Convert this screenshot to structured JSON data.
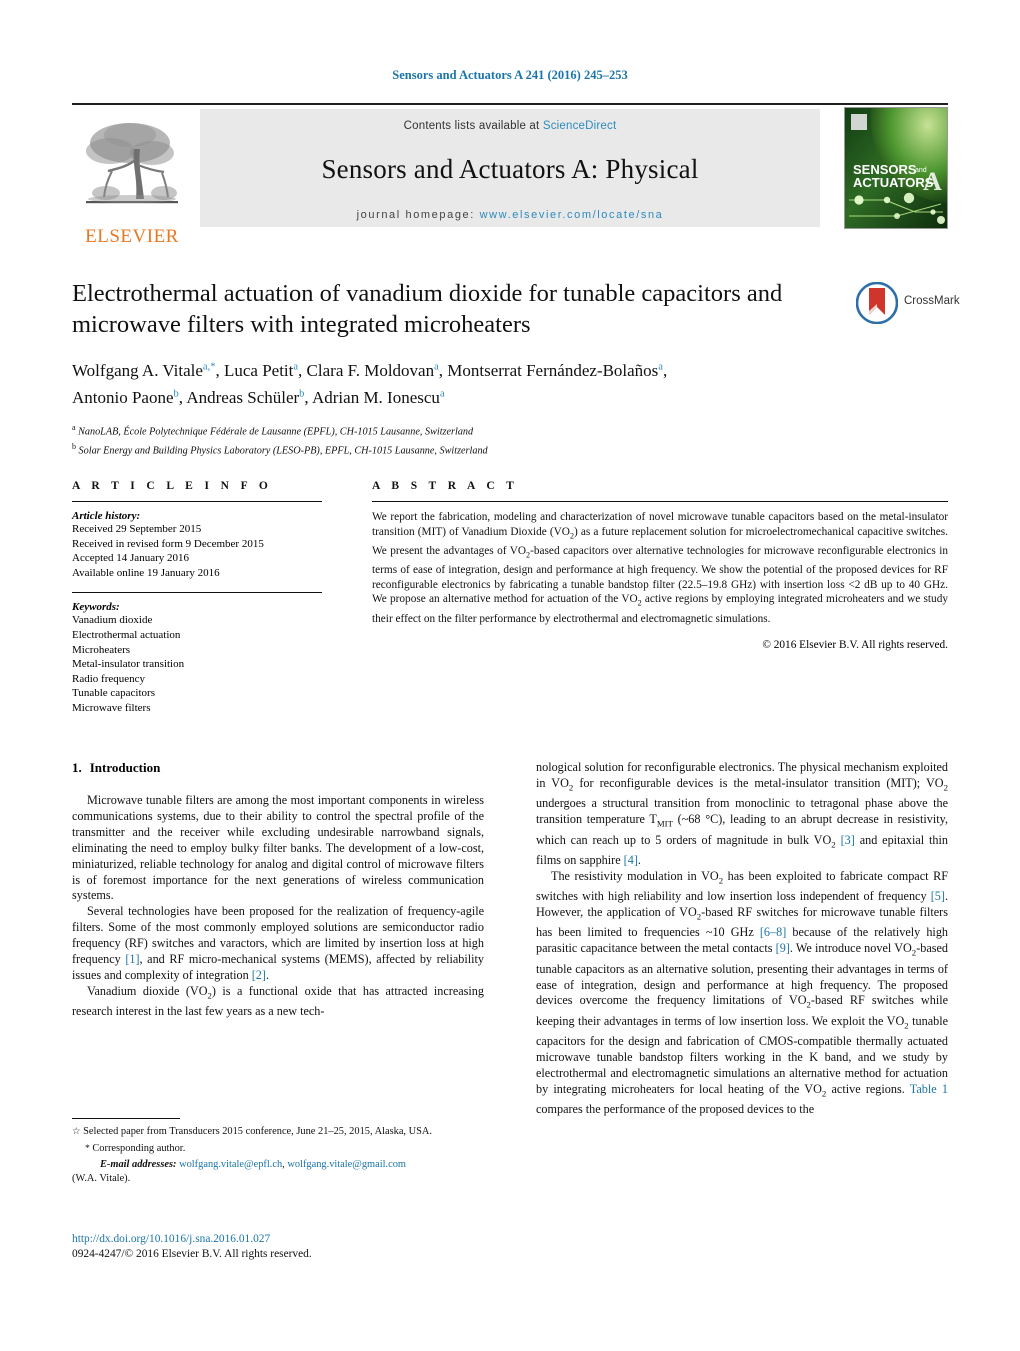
{
  "running_head": "Sensors and Actuators A 241 (2016) 245–253",
  "masthead": {
    "contents_prefix": "Contents lists available at ",
    "contents_link": "ScienceDirect",
    "journal_title": "Sensors and Actuators A: Physical",
    "homepage_prefix": "journal homepage:",
    "homepage_url": "www.elsevier.com/locate/sna",
    "publisher_logo": "elsevier-tree-logo",
    "publisher_name": "ELSEVIER",
    "cover_line1": "SENSORS",
    "cover_and": "and",
    "cover_line2": "ACTUATORS",
    "cover_letter": "A"
  },
  "article": {
    "title": "Electrothermal actuation of vanadium dioxide for tunable capacitors and microwave filters with integrated microheaters",
    "crossmark_label": "CrossMark",
    "authors_line1_parts": [
      {
        "name": "Wolfgang A. Vitale",
        "sup": "a,*"
      },
      {
        "name": "Luca Petit",
        "sup": "a"
      },
      {
        "name": "Clara F. Moldovan",
        "sup": "a"
      },
      {
        "name": "Montserrat Fernández-Bolaños",
        "sup": "a"
      }
    ],
    "authors_line2_parts": [
      {
        "name": "Antonio Paone",
        "sup": "b"
      },
      {
        "name": "Andreas Schüler",
        "sup": "b"
      },
      {
        "name": "Adrian M. Ionescu",
        "sup": "a"
      }
    ],
    "affiliations": [
      {
        "mark": "a",
        "text": "NanoLAB, École Polytechnique Fédérale de Lausanne (EPFL), CH-1015 Lausanne, Switzerland"
      },
      {
        "mark": "b",
        "text": "Solar Energy and Building Physics Laboratory (LESO-PB), EPFL, CH-1015 Lausanne, Switzerland"
      }
    ]
  },
  "article_info": {
    "heading": "A R T I C L E    I N F O",
    "history_label": "Article history:",
    "history": [
      "Received 29 September 2015",
      "Received in revised form 9 December 2015",
      "Accepted 14 January 2016",
      "Available online 19 January 2016"
    ],
    "keywords_label": "Keywords:",
    "keywords": [
      "Vanadium dioxide",
      "Electrothermal actuation",
      "Microheaters",
      "Metal-insulator transition",
      "Radio frequency",
      "Tunable capacitors",
      "Microwave filters"
    ]
  },
  "abstract": {
    "heading": "A B S T R A C T",
    "copyright": "© 2016 Elsevier B.V. All rights reserved."
  },
  "sections": {
    "intro_number": "1.",
    "intro_title": "Introduction"
  },
  "footnotes": {
    "star_mark": "☆",
    "star_text": "Selected paper from Transducers 2015 conference, June 21–25, 2015, Alaska, USA.",
    "corresponding_mark": "*",
    "corresponding_text": "Corresponding author.",
    "email_label": "E-mail addresses:",
    "email_1": "wolfgang.vitale@epfl.ch",
    "email_sep": ",",
    "email_2": "wolfgang.vitale@gmail.com",
    "email_owner": "(W.A. Vitale)."
  },
  "footer": {
    "doi": "http://dx.doi.org/10.1016/j.sna.2016.01.027",
    "issn_line": "0924-4247/© 2016 Elsevier B.V. All rights reserved."
  },
  "colors": {
    "link_blue": "#1b75a8",
    "sd_blue": "#2b8bbe",
    "elsevier_orange": "#e87722",
    "band_gray": "#e9e9e9"
  }
}
